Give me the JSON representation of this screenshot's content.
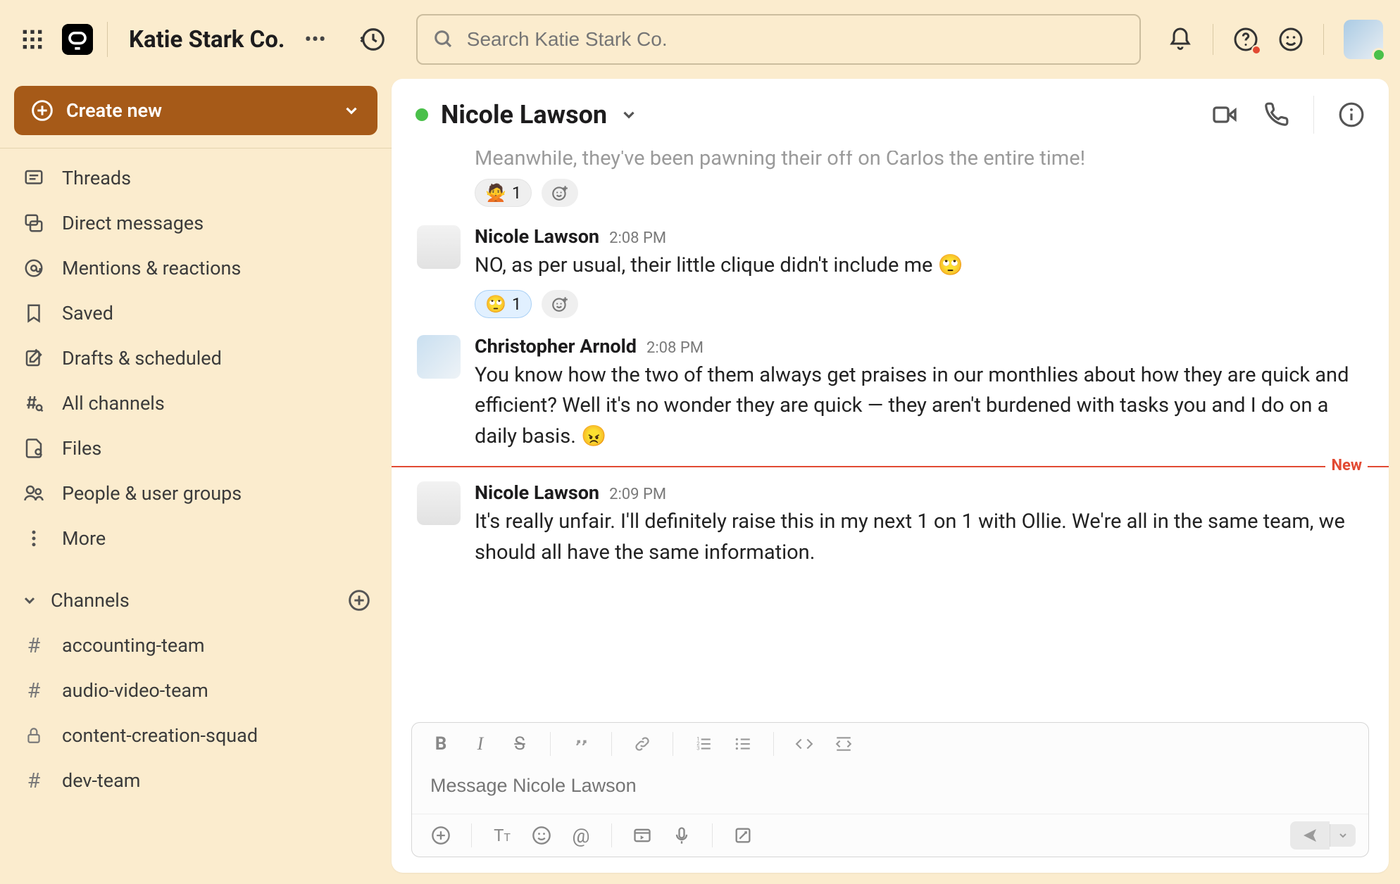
{
  "header": {
    "org_name": "Katie Stark Co.",
    "search_placeholder": "Search Katie Stark Co."
  },
  "sidebar": {
    "create_label": "Create new",
    "nav": [
      {
        "label": "Threads",
        "icon": "threads"
      },
      {
        "label": "Direct messages",
        "icon": "dm"
      },
      {
        "label": "Mentions & reactions",
        "icon": "mentions"
      },
      {
        "label": "Saved",
        "icon": "bookmark"
      },
      {
        "label": "Drafts & scheduled",
        "icon": "drafts"
      },
      {
        "label": "All channels",
        "icon": "allchannels"
      },
      {
        "label": "Files",
        "icon": "files"
      },
      {
        "label": "People & user groups",
        "icon": "people"
      },
      {
        "label": "More",
        "icon": "more"
      }
    ],
    "channels_heading": "Channels",
    "channels": [
      {
        "label": "accounting-team",
        "icon": "hash"
      },
      {
        "label": "audio-video-team",
        "icon": "hash"
      },
      {
        "label": "content-creation-squad",
        "icon": "lock"
      },
      {
        "label": "dev-team",
        "icon": "hash"
      }
    ]
  },
  "chat": {
    "title": "Nicole Lawson",
    "cutoff_text": "Meanwhile, they've been pawning their off on Carlos the entire time!",
    "cutoff_reaction": {
      "emoji": "🙅",
      "count": "1"
    },
    "messages": [
      {
        "author": "Nicole Lawson",
        "time": "2:08 PM",
        "avatar": "n",
        "text": "NO, as per usual, their little clique didn't include me 🙄",
        "reactions": [
          {
            "emoji": "🙄",
            "count": "1",
            "selected": true
          }
        ]
      },
      {
        "author": "Christopher Arnold",
        "time": "2:08 PM",
        "avatar": "c",
        "text": "You know how the two of them always get praises in our monthlies about how they are quick and efficient? Well it's no wonder they are quick — they aren't burdened with tasks you and I do on a daily basis. 😠",
        "reactions": []
      }
    ],
    "new_label": "New",
    "after_new": [
      {
        "author": "Nicole Lawson",
        "time": "2:09 PM",
        "avatar": "n",
        "text": "It's really unfair. I'll definitely raise this in my next 1 on 1 with Ollie. We're all in the same team, we should all have the same information.",
        "reactions": []
      }
    ],
    "composer_placeholder": "Message Nicole Lawson"
  }
}
